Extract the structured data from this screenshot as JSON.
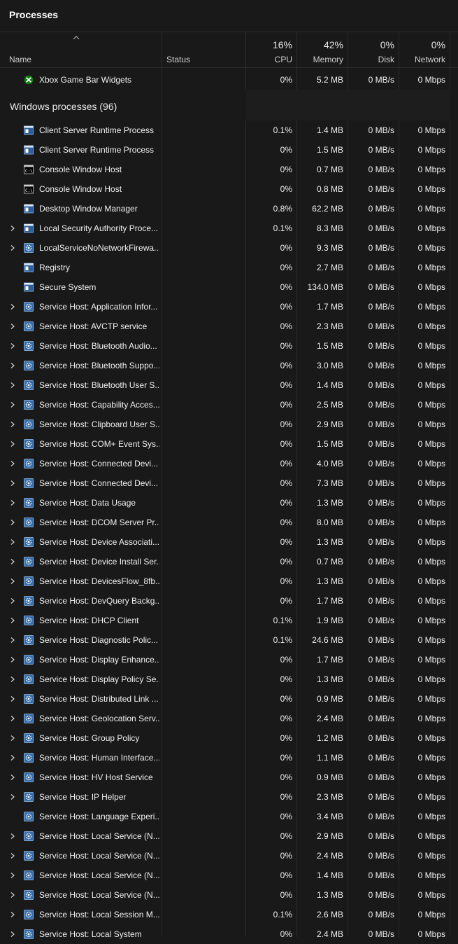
{
  "window": {
    "title": "Processes"
  },
  "columns": {
    "name": "Name",
    "status": "Status",
    "cpu": {
      "pct": "16%",
      "label": "CPU"
    },
    "memory": {
      "pct": "42%",
      "label": "Memory"
    },
    "disk": {
      "pct": "0%",
      "label": "Disk"
    },
    "network": {
      "pct": "0%",
      "label": "Network"
    }
  },
  "app_rows": [
    {
      "name": "Xbox Game Bar Widgets",
      "icon": "xbox-icon",
      "expandable": false,
      "cpu": "0%",
      "memory": "5.2 MB",
      "disk": "0 MB/s",
      "network": "0 Mbps"
    }
  ],
  "group": {
    "label": "Windows processes (96)"
  },
  "processes": [
    {
      "name": "Client Server Runtime Process",
      "icon": "window-app-icon",
      "expandable": false,
      "cpu": "0.1%",
      "memory": "1.4 MB",
      "disk": "0 MB/s",
      "network": "0 Mbps"
    },
    {
      "name": "Client Server Runtime Process",
      "icon": "window-app-icon",
      "expandable": false,
      "cpu": "0%",
      "memory": "1.5 MB",
      "disk": "0 MB/s",
      "network": "0 Mbps"
    },
    {
      "name": "Console Window Host",
      "icon": "console-icon",
      "expandable": false,
      "cpu": "0%",
      "memory": "0.7 MB",
      "disk": "0 MB/s",
      "network": "0 Mbps"
    },
    {
      "name": "Console Window Host",
      "icon": "console-icon",
      "expandable": false,
      "cpu": "0%",
      "memory": "0.8 MB",
      "disk": "0 MB/s",
      "network": "0 Mbps"
    },
    {
      "name": "Desktop Window Manager",
      "icon": "window-app-icon",
      "expandable": false,
      "cpu": "0.8%",
      "memory": "62.2 MB",
      "disk": "0 MB/s",
      "network": "0 Mbps"
    },
    {
      "name": "Local Security Authority Proce...",
      "icon": "window-app-icon",
      "expandable": true,
      "cpu": "0.1%",
      "memory": "8.3 MB",
      "disk": "0 MB/s",
      "network": "0 Mbps"
    },
    {
      "name": "LocalServiceNoNetworkFirewa...",
      "icon": "gear-icon",
      "expandable": true,
      "cpu": "0%",
      "memory": "9.3 MB",
      "disk": "0 MB/s",
      "network": "0 Mbps"
    },
    {
      "name": "Registry",
      "icon": "window-app-icon",
      "expandable": false,
      "cpu": "0%",
      "memory": "2.7 MB",
      "disk": "0 MB/s",
      "network": "0 Mbps"
    },
    {
      "name": "Secure System",
      "icon": "window-app-icon",
      "expandable": false,
      "cpu": "0%",
      "memory": "134.0 MB",
      "disk": "0 MB/s",
      "network": "0 Mbps"
    },
    {
      "name": "Service Host: Application Infor...",
      "icon": "gear-icon",
      "expandable": true,
      "cpu": "0%",
      "memory": "1.7 MB",
      "disk": "0 MB/s",
      "network": "0 Mbps"
    },
    {
      "name": "Service Host: AVCTP service",
      "icon": "gear-icon",
      "expandable": true,
      "cpu": "0%",
      "memory": "2.3 MB",
      "disk": "0 MB/s",
      "network": "0 Mbps"
    },
    {
      "name": "Service Host: Bluetooth Audio...",
      "icon": "gear-icon",
      "expandable": true,
      "cpu": "0%",
      "memory": "1.5 MB",
      "disk": "0 MB/s",
      "network": "0 Mbps"
    },
    {
      "name": "Service Host: Bluetooth Suppo...",
      "icon": "gear-icon",
      "expandable": true,
      "cpu": "0%",
      "memory": "3.0 MB",
      "disk": "0 MB/s",
      "network": "0 Mbps"
    },
    {
      "name": "Service Host: Bluetooth User S...",
      "icon": "gear-icon",
      "expandable": true,
      "cpu": "0%",
      "memory": "1.4 MB",
      "disk": "0 MB/s",
      "network": "0 Mbps"
    },
    {
      "name": "Service Host: Capability Acces...",
      "icon": "gear-icon",
      "expandable": true,
      "cpu": "0%",
      "memory": "2.5 MB",
      "disk": "0 MB/s",
      "network": "0 Mbps"
    },
    {
      "name": "Service Host: Clipboard User S...",
      "icon": "gear-icon",
      "expandable": true,
      "cpu": "0%",
      "memory": "2.9 MB",
      "disk": "0 MB/s",
      "network": "0 Mbps"
    },
    {
      "name": "Service Host: COM+ Event Sys...",
      "icon": "gear-icon",
      "expandable": true,
      "cpu": "0%",
      "memory": "1.5 MB",
      "disk": "0 MB/s",
      "network": "0 Mbps"
    },
    {
      "name": "Service Host: Connected Devi...",
      "icon": "gear-icon",
      "expandable": true,
      "cpu": "0%",
      "memory": "4.0 MB",
      "disk": "0 MB/s",
      "network": "0 Mbps"
    },
    {
      "name": "Service Host: Connected Devi...",
      "icon": "gear-icon",
      "expandable": true,
      "cpu": "0%",
      "memory": "7.3 MB",
      "disk": "0 MB/s",
      "network": "0 Mbps"
    },
    {
      "name": "Service Host: Data Usage",
      "icon": "gear-icon",
      "expandable": true,
      "cpu": "0%",
      "memory": "1.3 MB",
      "disk": "0 MB/s",
      "network": "0 Mbps"
    },
    {
      "name": "Service Host: DCOM Server Pr...",
      "icon": "gear-icon",
      "expandable": true,
      "cpu": "0%",
      "memory": "8.0 MB",
      "disk": "0 MB/s",
      "network": "0 Mbps"
    },
    {
      "name": "Service Host: Device Associati...",
      "icon": "gear-icon",
      "expandable": true,
      "cpu": "0%",
      "memory": "1.3 MB",
      "disk": "0 MB/s",
      "network": "0 Mbps"
    },
    {
      "name": "Service Host: Device Install Ser...",
      "icon": "gear-icon",
      "expandable": true,
      "cpu": "0%",
      "memory": "0.7 MB",
      "disk": "0 MB/s",
      "network": "0 Mbps"
    },
    {
      "name": "Service Host: DevicesFlow_8fb...",
      "icon": "gear-icon",
      "expandable": true,
      "cpu": "0%",
      "memory": "1.3 MB",
      "disk": "0 MB/s",
      "network": "0 Mbps"
    },
    {
      "name": "Service Host: DevQuery Backg...",
      "icon": "gear-icon",
      "expandable": true,
      "cpu": "0%",
      "memory": "1.7 MB",
      "disk": "0 MB/s",
      "network": "0 Mbps"
    },
    {
      "name": "Service Host: DHCP Client",
      "icon": "gear-icon",
      "expandable": true,
      "cpu": "0.1%",
      "memory": "1.9 MB",
      "disk": "0 MB/s",
      "network": "0 Mbps"
    },
    {
      "name": "Service Host: Diagnostic Polic...",
      "icon": "gear-icon",
      "expandable": true,
      "cpu": "0.1%",
      "memory": "24.6 MB",
      "disk": "0 MB/s",
      "network": "0 Mbps"
    },
    {
      "name": "Service Host: Display Enhance...",
      "icon": "gear-icon",
      "expandable": true,
      "cpu": "0%",
      "memory": "1.7 MB",
      "disk": "0 MB/s",
      "network": "0 Mbps"
    },
    {
      "name": "Service Host: Display Policy Se...",
      "icon": "gear-icon",
      "expandable": true,
      "cpu": "0%",
      "memory": "1.3 MB",
      "disk": "0 MB/s",
      "network": "0 Mbps"
    },
    {
      "name": "Service Host: Distributed Link ...",
      "icon": "gear-icon",
      "expandable": true,
      "cpu": "0%",
      "memory": "0.9 MB",
      "disk": "0 MB/s",
      "network": "0 Mbps"
    },
    {
      "name": "Service Host: Geolocation Serv...",
      "icon": "gear-icon",
      "expandable": true,
      "cpu": "0%",
      "memory": "2.4 MB",
      "disk": "0 MB/s",
      "network": "0 Mbps"
    },
    {
      "name": "Service Host: Group Policy",
      "icon": "gear-icon",
      "expandable": true,
      "cpu": "0%",
      "memory": "1.2 MB",
      "disk": "0 MB/s",
      "network": "0 Mbps"
    },
    {
      "name": "Service Host: Human Interface...",
      "icon": "gear-icon",
      "expandable": true,
      "cpu": "0%",
      "memory": "1.1 MB",
      "disk": "0 MB/s",
      "network": "0 Mbps"
    },
    {
      "name": "Service Host: HV Host Service",
      "icon": "gear-icon",
      "expandable": true,
      "cpu": "0%",
      "memory": "0.9 MB",
      "disk": "0 MB/s",
      "network": "0 Mbps"
    },
    {
      "name": "Service Host: IP Helper",
      "icon": "gear-icon",
      "expandable": true,
      "cpu": "0%",
      "memory": "2.3 MB",
      "disk": "0 MB/s",
      "network": "0 Mbps"
    },
    {
      "name": "Service Host: Language Experi...",
      "icon": "gear-icon",
      "expandable": false,
      "cpu": "0%",
      "memory": "3.4 MB",
      "disk": "0 MB/s",
      "network": "0 Mbps"
    },
    {
      "name": "Service Host: Local Service (N...",
      "icon": "gear-icon",
      "expandable": true,
      "cpu": "0%",
      "memory": "2.9 MB",
      "disk": "0 MB/s",
      "network": "0 Mbps"
    },
    {
      "name": "Service Host: Local Service (N...",
      "icon": "gear-icon",
      "expandable": true,
      "cpu": "0%",
      "memory": "2.4 MB",
      "disk": "0 MB/s",
      "network": "0 Mbps"
    },
    {
      "name": "Service Host: Local Service (N...",
      "icon": "gear-icon",
      "expandable": true,
      "cpu": "0%",
      "memory": "1.4 MB",
      "disk": "0 MB/s",
      "network": "0 Mbps"
    },
    {
      "name": "Service Host: Local Service (N...",
      "icon": "gear-icon",
      "expandable": true,
      "cpu": "0%",
      "memory": "1.3 MB",
      "disk": "0 MB/s",
      "network": "0 Mbps"
    },
    {
      "name": "Service Host: Local Session M...",
      "icon": "gear-icon",
      "expandable": true,
      "cpu": "0.1%",
      "memory": "2.6 MB",
      "disk": "0 MB/s",
      "network": "0 Mbps"
    },
    {
      "name": "Service Host: Local System",
      "icon": "gear-icon",
      "expandable": true,
      "cpu": "0%",
      "memory": "2.4 MB",
      "disk": "0 MB/s",
      "network": "0 Mbps"
    }
  ]
}
